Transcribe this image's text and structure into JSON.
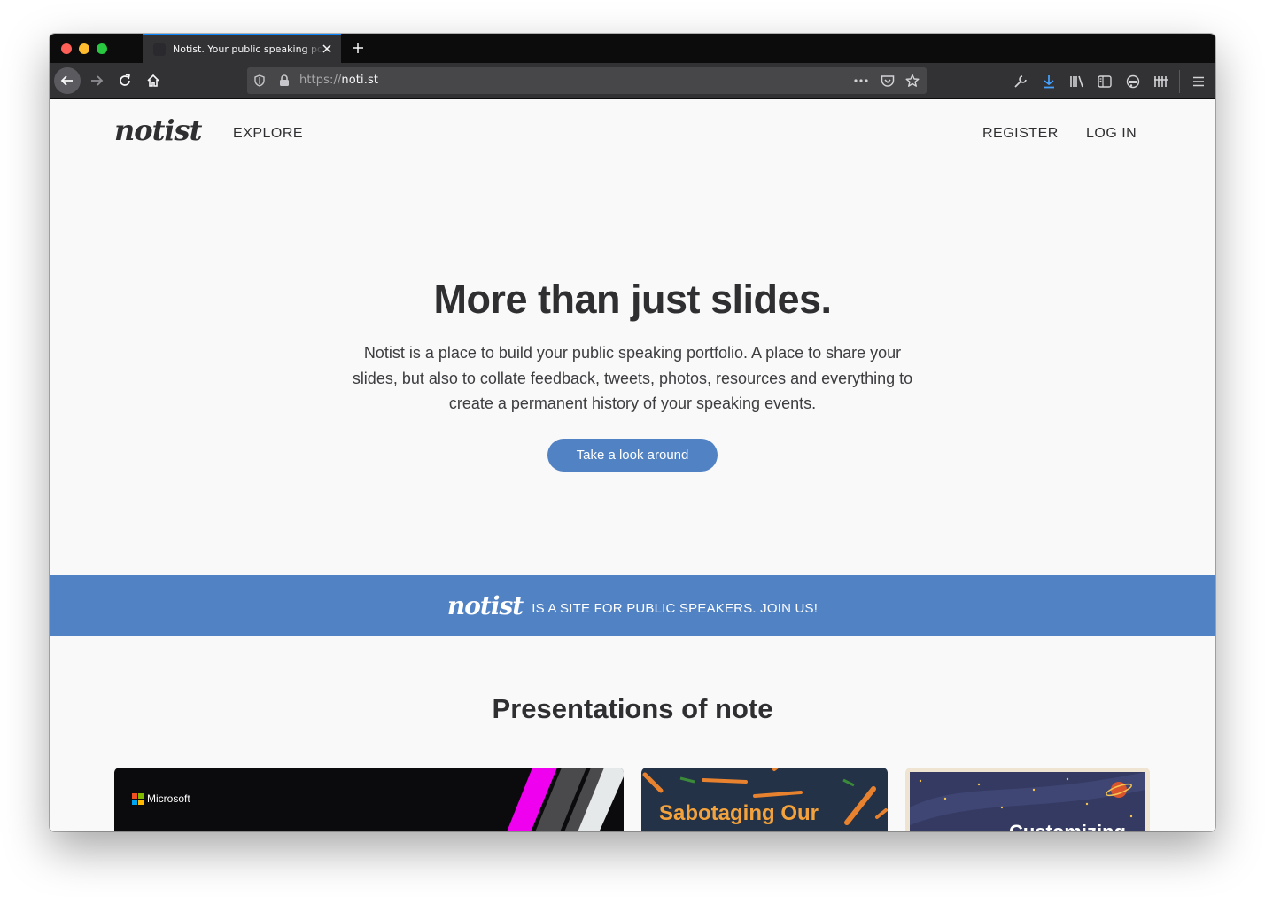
{
  "browser": {
    "tab_title": "Notist. Your public speaking portfolio.",
    "url_scheme": "https://",
    "url_host": "noti.st",
    "accent_color": "#0a84ff",
    "icons": [
      "back-arrow-icon",
      "forward-arrow-icon",
      "reload-icon",
      "home-icon",
      "shield-icon",
      "lock-icon",
      "more-icon",
      "pocket-icon",
      "star-icon",
      "wrench-icon",
      "download-icon",
      "library-icon",
      "sidebar-icon",
      "extension-icon",
      "bars-icon",
      "hamburger-menu-icon"
    ]
  },
  "site": {
    "logo": "notist",
    "brand_color": "#5183c4",
    "nav": {
      "explore": "EXPLORE",
      "register": "REGISTER",
      "login": "LOG IN"
    },
    "hero": {
      "title": "More than just slides.",
      "text": "Notist is a place to build your public speaking portfolio. A place to share your slides, but also to collate feedback, tweets, photos, resources and everything to create a permanent history of your speaking events.",
      "cta": "Take a look around"
    },
    "banner": {
      "logo": "notist",
      "text": "IS A SITE FOR PUBLIC SPEAKERS. JOIN US!"
    },
    "presentations": {
      "title": "Presentations of note",
      "cards": [
        {
          "label": "Microsoft"
        },
        {
          "label": "Sabotaging Our"
        },
        {
          "label": "Customizing"
        }
      ]
    }
  }
}
